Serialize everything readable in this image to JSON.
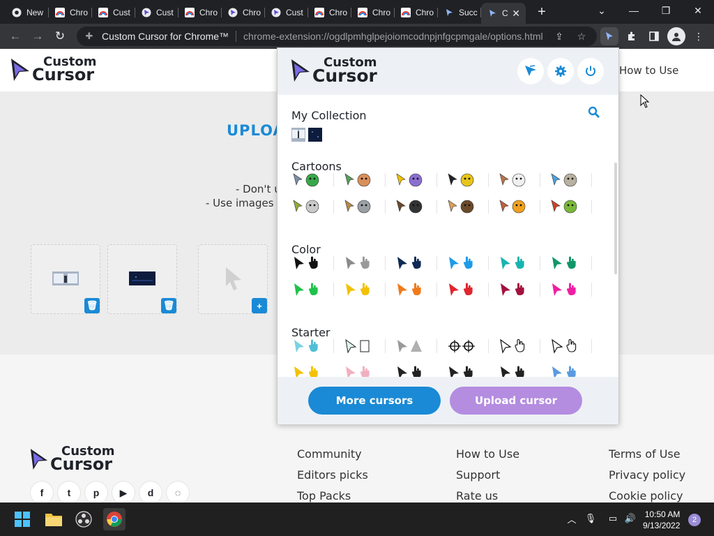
{
  "browser": {
    "tabs": [
      {
        "title": "New",
        "icon": "chrome-icon"
      },
      {
        "title": "Chro",
        "icon": "rainbow-icon"
      },
      {
        "title": "Cust",
        "icon": "rainbow-icon"
      },
      {
        "title": "Cust",
        "icon": "custom-cursor-icon"
      },
      {
        "title": "Chro",
        "icon": "rainbow-icon"
      },
      {
        "title": "Chro",
        "icon": "custom-cursor-icon"
      },
      {
        "title": "Cust",
        "icon": "custom-cursor-icon"
      },
      {
        "title": "Chro",
        "icon": "rainbow-icon"
      },
      {
        "title": "Chro",
        "icon": "rainbow-icon"
      },
      {
        "title": "Chro",
        "icon": "rainbow-icon"
      },
      {
        "title": "Succ",
        "icon": "cursor-icon"
      },
      {
        "title": "C",
        "icon": "cursor-icon",
        "active": true
      }
    ],
    "new_tab": "+",
    "omnibox": {
      "site_name": "Custom Cursor for Chrome™",
      "url": "chrome-extension://ogdlpmhglpejoiomcodnpjnfgcpmgale/options.html"
    }
  },
  "site": {
    "logo": {
      "line1": "Custom",
      "line2": "Cursor"
    },
    "nav_how_to_use": "How to Use",
    "upload_title": "UPLOA",
    "hint1": "- Don't u",
    "hint2": "- Use images v",
    "slot_actions": {
      "delete": "🗑",
      "add": "+"
    }
  },
  "popup": {
    "logo": {
      "line1": "Custom",
      "line2": "Cursor"
    },
    "sections": [
      {
        "title": "My Collection"
      },
      {
        "title": "Cartoons"
      },
      {
        "title": "Color"
      },
      {
        "title": "Starter"
      }
    ],
    "color_pairs": [
      [
        "#111111",
        "#111111"
      ],
      [
        "#8a8a8a",
        "#9a9a9a"
      ],
      [
        "#0f2a55",
        "#0f2a55"
      ],
      [
        "#1e9be8",
        "#1e9be8"
      ],
      [
        "#18b3b0",
        "#18b3b0"
      ],
      [
        "#11966a",
        "#11966a"
      ],
      [
        "#1fc24a",
        "#1fc24a"
      ],
      [
        "#f2c200",
        "#f2c200"
      ],
      [
        "#f07a1a",
        "#f07a1a"
      ],
      [
        "#e0262e",
        "#e0262e"
      ],
      [
        "#a2123f",
        "#a2123f"
      ],
      [
        "#ee1fa4",
        "#ee1fa4"
      ]
    ],
    "buttons": {
      "more": "More cursors",
      "upload": "Upload cursor"
    },
    "colors": {
      "more": "#1a8ad6",
      "upload": "#b48ce0"
    }
  },
  "footer": {
    "logo": {
      "line1": "Custom",
      "line2": "Cursor"
    },
    "col1": [
      "Community",
      "Editors picks",
      "Top Packs"
    ],
    "col2": [
      "How to Use",
      "Support",
      "Rate us"
    ],
    "col3": [
      "Terms of Use",
      "Privacy policy",
      "Cookie policy"
    ],
    "social": [
      "f",
      "t",
      "p",
      "▶",
      "d",
      "◌"
    ]
  },
  "taskbar": {
    "time": "10:50 AM",
    "date": "9/13/2022",
    "notifications": "2"
  }
}
